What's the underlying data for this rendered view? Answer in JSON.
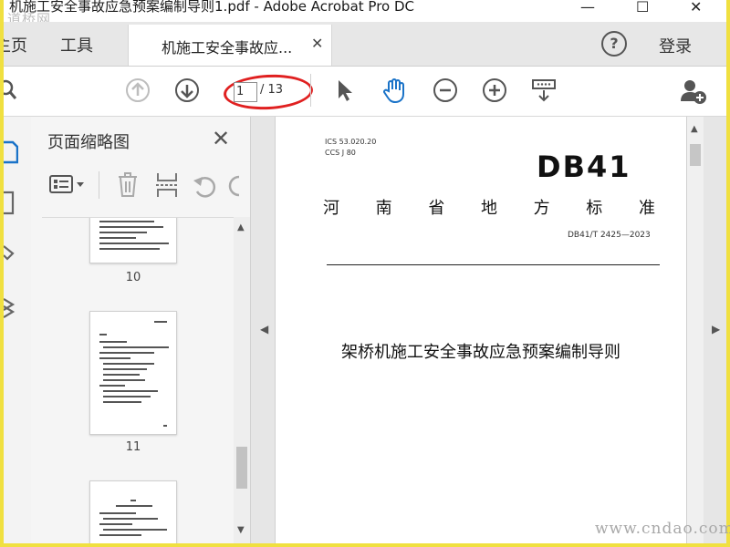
{
  "window": {
    "title": "机施工安全事故应急预案编制导则1.pdf - Adobe Acrobat Pro DC",
    "watermark_top": "道桥网",
    "watermark_bottom": "www.cndao.com",
    "minimize_glyph": "—",
    "maximize_glyph": "☐",
    "close_glyph": "✕"
  },
  "tabs": {
    "home": "主页",
    "tools": "工具",
    "document": "机施工安全事故应...",
    "document_close": "✕",
    "help": "?",
    "login": "登录"
  },
  "toolbar": {
    "current_page": "1",
    "total_pages": "/ 13",
    "icons": [
      "search-icon",
      "page-up-icon",
      "page-down-icon",
      "select-cursor-icon",
      "hand-tool-icon",
      "zoom-out-icon",
      "zoom-in-icon",
      "read-mode-icon",
      "share-user-icon"
    ]
  },
  "thumbnails_panel": {
    "title": "页面缩略图",
    "close": "✕",
    "items": [
      {
        "label": "10"
      },
      {
        "label": "11"
      }
    ]
  },
  "document": {
    "ics": "ICS  53.020.20",
    "ccs": "CCS  J 80",
    "code": "DB41",
    "standard_type": [
      "河",
      "南",
      "省",
      "地",
      "方",
      "标",
      "准"
    ],
    "number": "DB41/T 2425—2023",
    "title": "架桥机施工安全事故应急预案编制导则"
  },
  "colors": {
    "highlight_ellipse": "#e02020",
    "frame": "#f0e040",
    "hand_tool": "#1a73c8"
  }
}
